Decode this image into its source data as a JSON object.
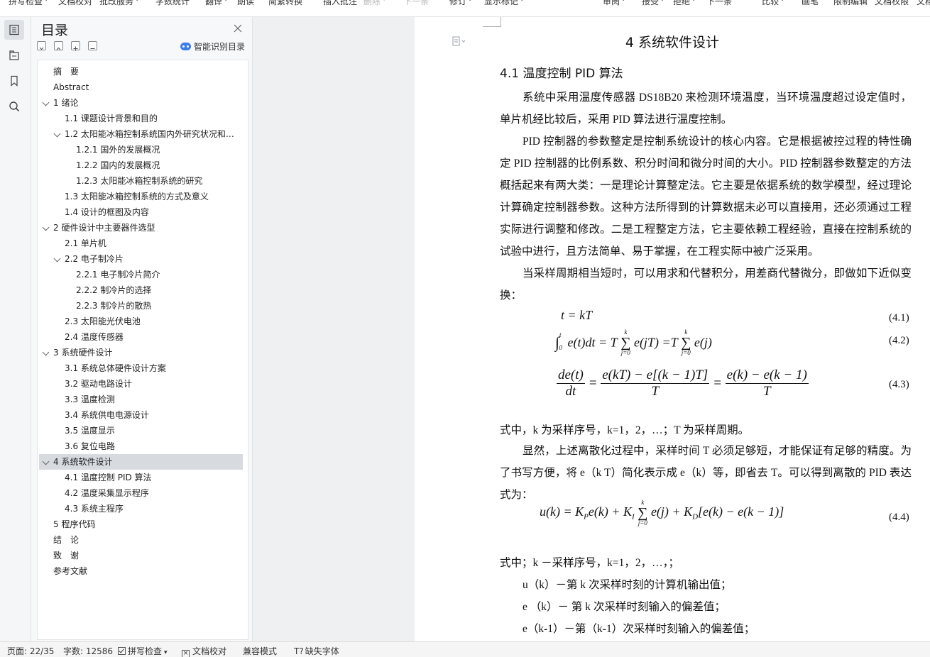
{
  "toolbar": {
    "items": [
      {
        "label": "拼写检查",
        "dropdown": true,
        "disabled": false
      },
      {
        "label": "文档校对",
        "dropdown": false,
        "disabled": false
      },
      {
        "label": "批改服务",
        "dropdown": true,
        "disabled": false
      },
      {
        "label": "字数统计",
        "dropdown": false,
        "disabled": false
      },
      {
        "label": "翻译",
        "dropdown": true,
        "disabled": false
      },
      {
        "label": "朗读",
        "dropdown": false,
        "disabled": false
      },
      {
        "label": "简繁转换",
        "dropdown": false,
        "disabled": false
      },
      {
        "label": "插入批注",
        "dropdown": false,
        "disabled": false
      },
      {
        "label": "删除",
        "dropdown": true,
        "disabled": true
      },
      {
        "label": "下一条",
        "dropdown": false,
        "disabled": true
      },
      {
        "label": "修订",
        "dropdown": true,
        "disabled": false
      },
      {
        "label": "显示标记",
        "dropdown": true,
        "disabled": false
      },
      {
        "label": "审阅",
        "dropdown": true,
        "disabled": false
      },
      {
        "label": "接受",
        "dropdown": true,
        "disabled": false
      },
      {
        "label": "拒绝",
        "dropdown": true,
        "disabled": false
      },
      {
        "label": "下一条",
        "dropdown": false,
        "disabled": false
      },
      {
        "label": "比较",
        "dropdown": true,
        "disabled": false
      },
      {
        "label": "画笔",
        "dropdown": false,
        "disabled": false
      },
      {
        "label": "限制编辑",
        "dropdown": false,
        "disabled": false
      },
      {
        "label": "文档权限",
        "dropdown": false,
        "disabled": false
      },
      {
        "label": "文档",
        "dropdown": false,
        "disabled": false
      }
    ]
  },
  "rail": {
    "icons": [
      "toc-icon",
      "nav-pane-icon",
      "bookmark-icon",
      "search-icon"
    ]
  },
  "toc": {
    "title": "目录",
    "smart_label": "智能识别目录",
    "items": [
      {
        "label": "摘　要",
        "level": 0,
        "chevron": false,
        "active": false
      },
      {
        "label": "Abstract",
        "level": 0,
        "chevron": false,
        "active": false
      },
      {
        "label": "1  绪论",
        "level": 0,
        "chevron": true,
        "active": false
      },
      {
        "label": "1.1 课题设计背景和目的",
        "level": 1,
        "chevron": false,
        "active": false
      },
      {
        "label": "1.2  太阳能冰箱控制系统国内外研究状况和…",
        "level": 1,
        "chevron": true,
        "active": false
      },
      {
        "label": "1.2.1 国外的发展概况",
        "level": 2,
        "chevron": false,
        "active": false
      },
      {
        "label": "1.2.2  国内的发展概况",
        "level": 2,
        "chevron": false,
        "active": false
      },
      {
        "label": "1.2.3  太阳能冰箱控制系统的研究",
        "level": 2,
        "chevron": false,
        "active": false
      },
      {
        "label": "1.3 太阳能冰箱控制系统的方式及意义",
        "level": 1,
        "chevron": false,
        "active": false
      },
      {
        "label": "1.4 设计的框图及内容",
        "level": 1,
        "chevron": false,
        "active": false
      },
      {
        "label": "2  硬件设计中主要器件选型",
        "level": 0,
        "chevron": true,
        "active": false
      },
      {
        "label": "2.1 单片机",
        "level": 1,
        "chevron": false,
        "active": false
      },
      {
        "label": "2.2  电子制冷片",
        "level": 1,
        "chevron": true,
        "active": false
      },
      {
        "label": "2.2.1  电子制冷片简介",
        "level": 2,
        "chevron": false,
        "active": false
      },
      {
        "label": "2.2.2  制冷片的选择",
        "level": 2,
        "chevron": false,
        "active": false
      },
      {
        "label": "2.2.3  制冷片的散热",
        "level": 2,
        "chevron": false,
        "active": false
      },
      {
        "label": "2.3  太阳能光伏电池",
        "level": 1,
        "chevron": false,
        "active": false
      },
      {
        "label": "2.4  温度传感器",
        "level": 1,
        "chevron": false,
        "active": false
      },
      {
        "label": "3  系统硬件设计",
        "level": 0,
        "chevron": true,
        "active": false
      },
      {
        "label": "3.1 系统总体硬件设计方案",
        "level": 1,
        "chevron": false,
        "active": false
      },
      {
        "label": "3.2  驱动电路设计",
        "level": 1,
        "chevron": false,
        "active": false
      },
      {
        "label": "3.3  温度检测",
        "level": 1,
        "chevron": false,
        "active": false
      },
      {
        "label": "3.4  系统供电电源设计",
        "level": 1,
        "chevron": false,
        "active": false
      },
      {
        "label": "3.5  温度显示",
        "level": 1,
        "chevron": false,
        "active": false
      },
      {
        "label": "3.6  复位电路",
        "level": 1,
        "chevron": false,
        "active": false
      },
      {
        "label": "4  系统软件设计",
        "level": 0,
        "chevron": true,
        "active": true
      },
      {
        "label": "4.1  温度控制 PID 算法",
        "level": 1,
        "chevron": false,
        "active": false
      },
      {
        "label": "4.2  温度采集显示程序",
        "level": 1,
        "chevron": false,
        "active": false
      },
      {
        "label": "4.3  系统主程序",
        "level": 1,
        "chevron": false,
        "active": false
      },
      {
        "label": "5  程序代码",
        "level": 0,
        "chevron": false,
        "active": false
      },
      {
        "label": "结　论",
        "level": 0,
        "chevron": false,
        "active": false
      },
      {
        "label": "致　谢",
        "level": 0,
        "chevron": false,
        "active": false
      },
      {
        "label": "参考文献",
        "level": 0,
        "chevron": false,
        "active": false
      }
    ]
  },
  "doc": {
    "chapter": "4  系统软件设计",
    "section": "4.1  温度控制 PID 算法",
    "p1": "系统中采用温度传感器 DS18B20 来检测环境温度，当环境温度超过设定值时，单片机经比较后，采用 PID 算法进行温度控制。",
    "p2": "PID 控制器的参数整定是控制系统设计的核心内容。它是根据被控过程的特性确定 PID 控制器的比例系数、积分时间和微分时间的大小。PID 控制器参数整定的方法概括起来有两大类：一是理论计算整定法。它主要是依据系统的数学模型，经过理论计算确定控制器参数。这种方法所得到的计算数据未必可以直接用，还必须通过工程实际进行调整和修改。二是工程整定方法，它主要依赖工程经验，直接在控制系统的试验中进行，且方法简单、易于掌握，在工程实际中被广泛采用。",
    "p3": "当采样周期相当短时，可以用求和代替积分，用差商代替微分，即做如下近似变换：",
    "eq": {
      "e1": "t = kT",
      "n1": "(4.1)",
      "n2": "(4.2)",
      "n3": "(4.3)",
      "n4": "(4.4)"
    },
    "p4": "式中，k 为采样序号，k=1，2，…；T 为采样周期。",
    "p5": "显然，上述离散化过程中，采样时间 T 必须足够短，才能保证有足够的精度。为了书写方便，将 e（k T）简化表示成 e（k）等，即省去 T。可以得到离散的 PID 表达式为：",
    "p6": "式中；k －采样序号，k=1，2，…，；",
    "p7": "u（k）－第 k 次采样时刻的计算机输出值；",
    "p8": "e （k）－ 第 k 次采样时刻输入的偏差值；",
    "p9": "e（k-1）－第（k-1）次采样时刻输入的偏差值；"
  },
  "status": {
    "page": "页面: 22/35",
    "words": "字数: 12586",
    "spell": "拼写检查",
    "proof": "文档校对",
    "compat": "兼容模式",
    "missing_font": "缺失字体"
  },
  "colors": {
    "accent": "#3b7ded",
    "active_row": "#d7dbe0",
    "gutter": "#eef0f2"
  }
}
